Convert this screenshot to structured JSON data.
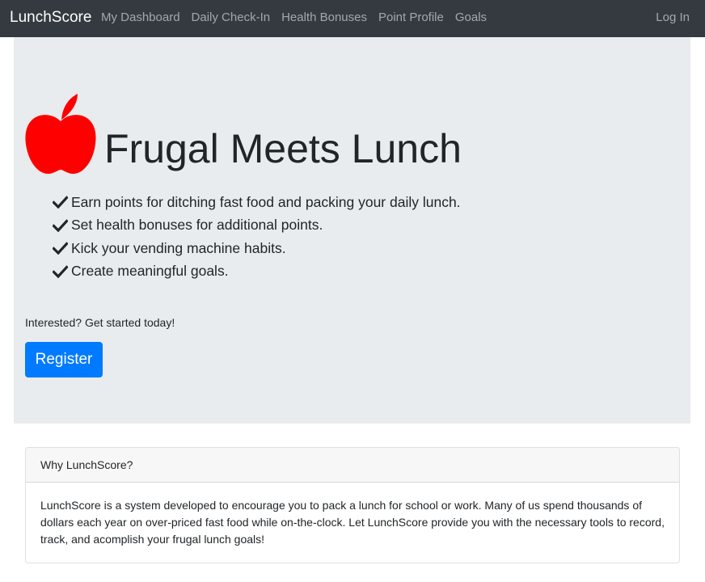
{
  "navbar": {
    "brand": "LunchScore",
    "links": [
      "My Dashboard",
      "Daily Check-In",
      "Health Bonuses",
      "Point Profile",
      "Goals"
    ],
    "login": "Log In"
  },
  "hero": {
    "logo_icon": "apple-icon",
    "logo_color": "#ff0000",
    "title": "Frugal Meets Lunch",
    "features": [
      "Earn points for ditching fast food and packing your daily lunch.",
      "Set health bonuses for additional points.",
      "Kick your vending machine habits.",
      "Create meaningful goals."
    ],
    "feature_icon": "checkmark-icon",
    "prompt": "Interested? Get started today!",
    "register_label": "Register",
    "accent_color": "#007bff"
  },
  "info_card": {
    "header": "Why LunchScore?",
    "body": "LunchScore is a system developed to encourage you to pack a lunch for school or work. Many of us spend thousands of dollars each year on over-priced fast food while on-the-clock. Let LunchScore provide you with the necessary tools to record, track, and acomplish your frugal lunch goals!"
  }
}
